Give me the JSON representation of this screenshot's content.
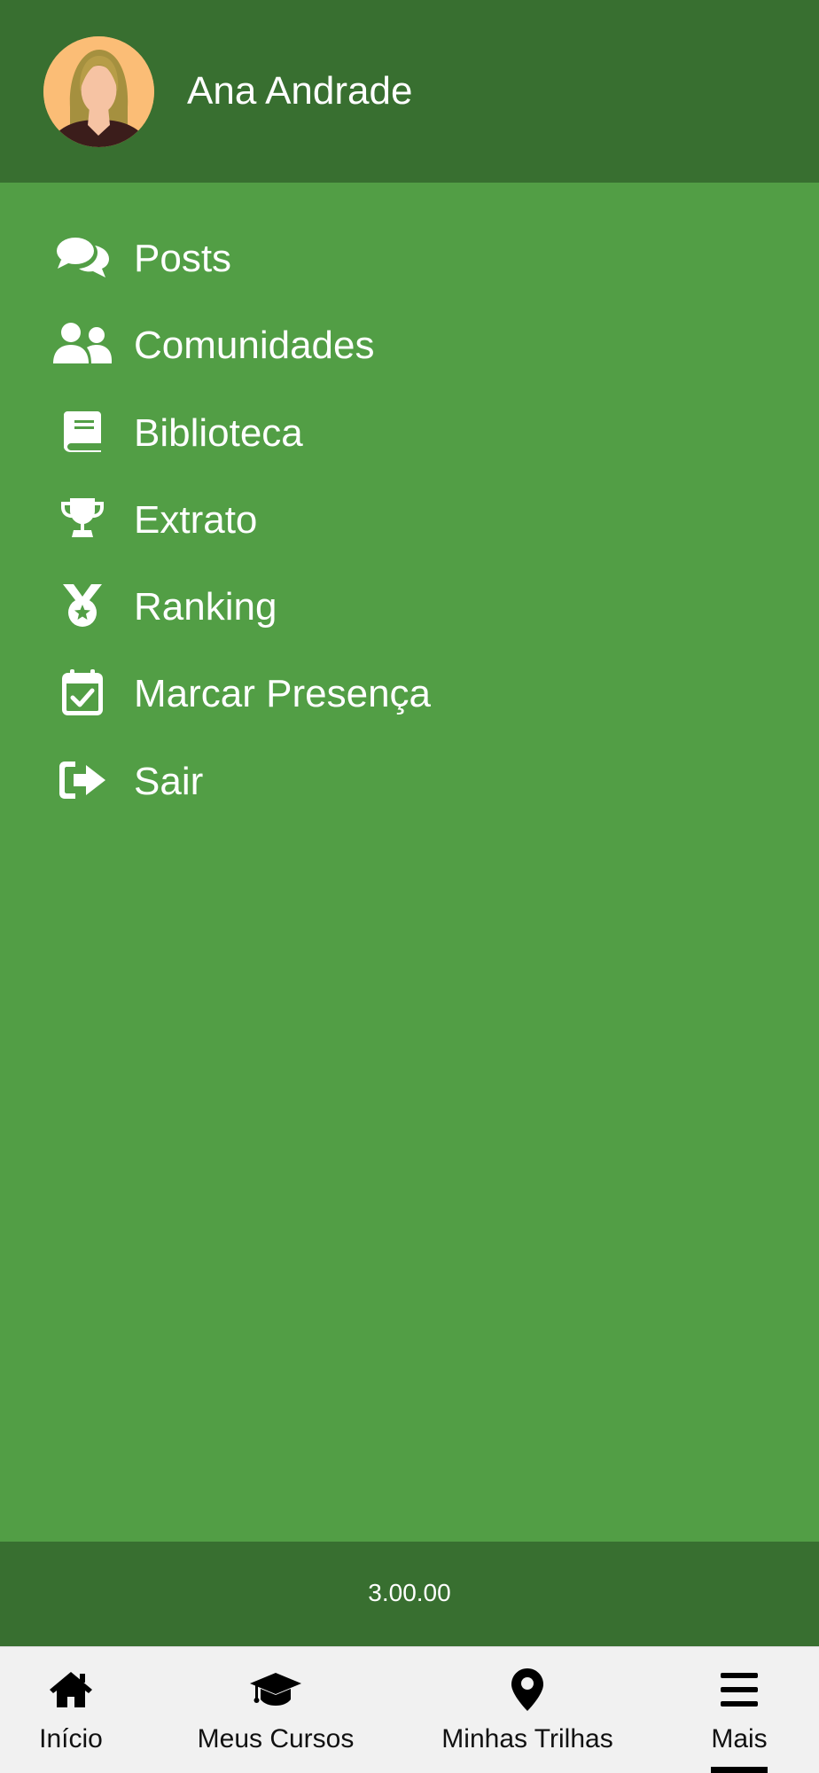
{
  "header": {
    "user_name": "Ana Andrade"
  },
  "menu": {
    "items": [
      {
        "label": "Posts",
        "icon": "comments-icon"
      },
      {
        "label": "Comunidades",
        "icon": "users-icon"
      },
      {
        "label": "Biblioteca",
        "icon": "book-icon"
      },
      {
        "label": "Extrato",
        "icon": "trophy-icon"
      },
      {
        "label": "Ranking",
        "icon": "medal-icon"
      },
      {
        "label": "Marcar Presença",
        "icon": "calendar-check-icon"
      },
      {
        "label": "Sair",
        "icon": "sign-out-icon"
      }
    ]
  },
  "footer": {
    "version": "3.00.00"
  },
  "bottom_nav": {
    "items": [
      {
        "label": "Início",
        "icon": "home-icon"
      },
      {
        "label": "Meus Cursos",
        "icon": "graduation-cap-icon"
      },
      {
        "label": "Minhas Trilhas",
        "icon": "map-marker-icon"
      },
      {
        "label": "Mais",
        "icon": "menu-bars-icon"
      }
    ],
    "active": "Mais"
  },
  "colors": {
    "header_bg": "#386f30",
    "menu_bg": "#529e45",
    "nav_bg": "#f1f1f1",
    "text_light": "#ffffff",
    "text_dark": "#111111"
  }
}
